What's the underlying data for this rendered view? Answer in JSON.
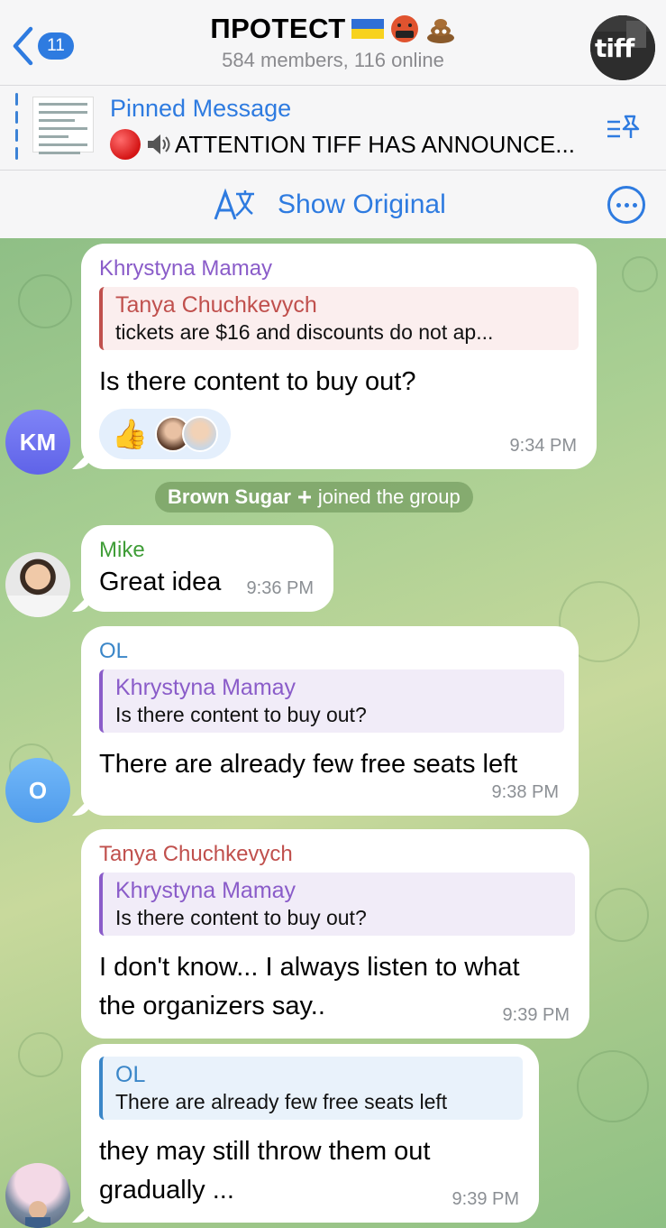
{
  "header": {
    "back_count": "11",
    "title": "ПРОТЕСТ",
    "subtitle": "584 members, 116 online",
    "avatar_text": "tiff"
  },
  "pinned": {
    "title": "Pinned Message",
    "text": "ATTENTION TIFF HAS ANNOUNCE..."
  },
  "translate": {
    "label": "Show Original"
  },
  "messages": [
    {
      "sender": "Khrystyna Mamay",
      "sender_color": "#8a5cc9",
      "avatar_initials": "KM",
      "reply_name": "Tanya Chuchkevych",
      "reply_text": "tickets are $16 and discounts do not ap...",
      "text": "Is there content to buy out?",
      "reaction": "👍",
      "time": "9:34 PM"
    },
    {
      "service": "Brown Sugar",
      "service_rest": "joined the group"
    },
    {
      "sender": "Mike",
      "sender_color": "#3f9d37",
      "text": "Great idea",
      "time": "9:36 PM"
    },
    {
      "sender": "OL",
      "sender_color": "#3a86c8",
      "avatar_initials": "O",
      "reply_name": "Khrystyna Mamay",
      "reply_text": "Is there content to buy out?",
      "text": "There are already few free seats left",
      "time": "9:38 PM"
    },
    {
      "sender": "Tanya Chuchkevych",
      "sender_color": "#c0504d",
      "reply_name": "Khrystyna Mamay",
      "reply_text": "Is there content to buy out?",
      "text_line1": "I don't know... I always listen to what",
      "text_line2": "the organizers say..",
      "time": "9:39 PM"
    },
    {
      "reply_name": "OL",
      "reply_text": "There are already few free seats left",
      "text_line1": "they may still throw them out",
      "text_line2": "gradually ...",
      "time": "9:39 PM"
    }
  ],
  "colors": {
    "accent": "#2e7be0",
    "km_avatar": "#6e72f0",
    "o_avatar": "#5aa7f5"
  }
}
